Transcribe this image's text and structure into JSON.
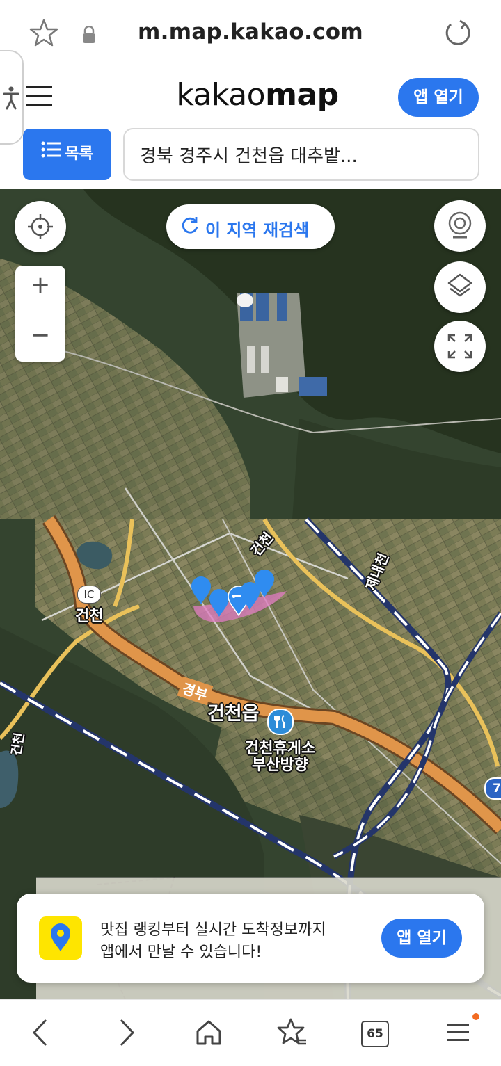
{
  "browser": {
    "url": "m.map.kakao.com",
    "icons": [
      "star-outline-icon",
      "lock-icon",
      "reload-icon"
    ],
    "tab_count": "65"
  },
  "header": {
    "logo_regular": "kakao",
    "logo_bold": "map",
    "app_open_label": "앱 열기",
    "list_button_label": "목록",
    "search_value": "경북 경주시 건천읍 대추밭..."
  },
  "map_controls": {
    "research_label": "이 지역 재검색",
    "zoom_in": "+",
    "zoom_out": "−"
  },
  "map_labels": {
    "ic_badge": "IC",
    "ic_name": "건천",
    "stream_top": "건천",
    "stream_right": "제내천",
    "town": "건천읍",
    "highway_name": "경부",
    "rest_area_line1": "건천휴게소",
    "rest_area_line2": "부산방향",
    "left_edge": "건천",
    "route_badge": "7"
  },
  "promo": {
    "line1": "맛집 랭킹부터 실시간 도착정보까지",
    "line2": "앱에서 만날 수 있습니다!",
    "button_label": "앱 열기"
  },
  "colors": {
    "accent_blue": "#2b77ee",
    "kakao_yellow": "#fee500",
    "highway_orange": "#e0954a",
    "marker_blue": "#2f8cf0"
  }
}
